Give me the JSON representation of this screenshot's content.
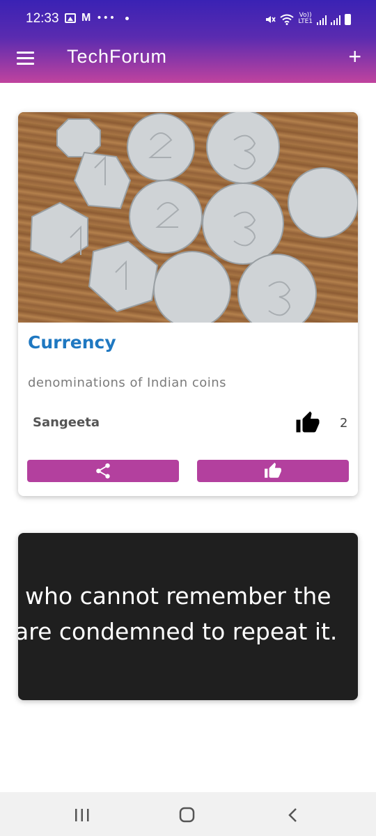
{
  "status_bar": {
    "time": "12:33",
    "network_label_top": "Vo))",
    "network_label_bottom": "LTE1",
    "icons": [
      "gallery-icon",
      "gmail-icon",
      "more-dots-icon",
      "dot-icon",
      "mute-icon",
      "wifi-icon",
      "signal-icon",
      "signal-r-icon",
      "battery-icon"
    ]
  },
  "app_bar": {
    "title": "TechForum",
    "menu_icon": "hamburger-menu-icon",
    "add_icon": "plus-icon",
    "colors": {
      "gradient_top": "#3a22b4",
      "gradient_bottom": "#c0439e"
    }
  },
  "posts": [
    {
      "title": "Currency",
      "description": "denominations of Indian coins",
      "author": "Sangeeta",
      "likes": "2",
      "image": "photo-of-indian-coins",
      "actions": {
        "share_icon": "share-icon",
        "like_icon": "thumbs-up-icon"
      },
      "colors": {
        "title": "#1f78c1",
        "button": "#b3409e"
      }
    },
    {
      "image_text_line_1": "who cannot remember the",
      "image_text_line_2": "are condemned to repeat it."
    }
  ],
  "nav_bar": {
    "recent_icon": "recent-apps-icon",
    "home_icon": "home-icon",
    "back_icon": "back-icon"
  }
}
